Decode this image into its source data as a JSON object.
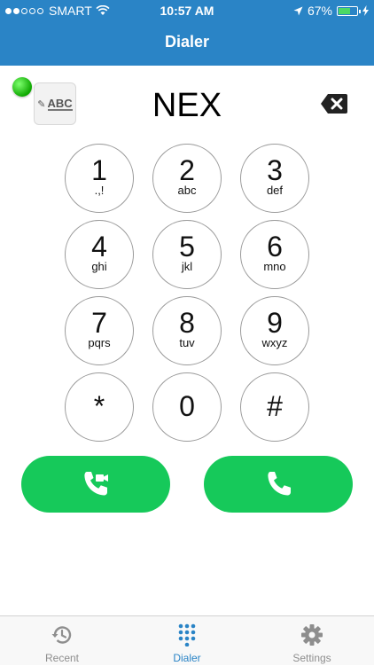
{
  "status_bar": {
    "carrier": "SMART",
    "time": "10:57 AM",
    "battery": "67%",
    "battery_level": 0.67
  },
  "header": {
    "title": "Dialer"
  },
  "controls": {
    "abc_label": "ABC"
  },
  "display": {
    "number": "NEX"
  },
  "keypad": [
    {
      "digit": "1",
      "letters": ".,!"
    },
    {
      "digit": "2",
      "letters": "abc"
    },
    {
      "digit": "3",
      "letters": "def"
    },
    {
      "digit": "4",
      "letters": "ghi"
    },
    {
      "digit": "5",
      "letters": "jkl"
    },
    {
      "digit": "6",
      "letters": "mno"
    },
    {
      "digit": "7",
      "letters": "pqrs"
    },
    {
      "digit": "8",
      "letters": "tuv"
    },
    {
      "digit": "9",
      "letters": "wxyz"
    },
    {
      "digit": "*",
      "letters": ""
    },
    {
      "digit": "0",
      "letters": ""
    },
    {
      "digit": "#",
      "letters": ""
    }
  ],
  "call_buttons": {
    "video_icon": "phone-video-icon",
    "voice_icon": "phone-icon",
    "color": "#16c95a"
  },
  "tabbar": {
    "tabs": [
      {
        "label": "Recent",
        "icon": "history-icon"
      },
      {
        "label": "Dialer",
        "icon": "keypad-grid-icon",
        "active": true
      },
      {
        "label": "Settings",
        "icon": "gear-icon"
      }
    ]
  },
  "colors": {
    "header": "#2a84c6",
    "accent": "#2a84c6",
    "led": "#0ea800"
  }
}
